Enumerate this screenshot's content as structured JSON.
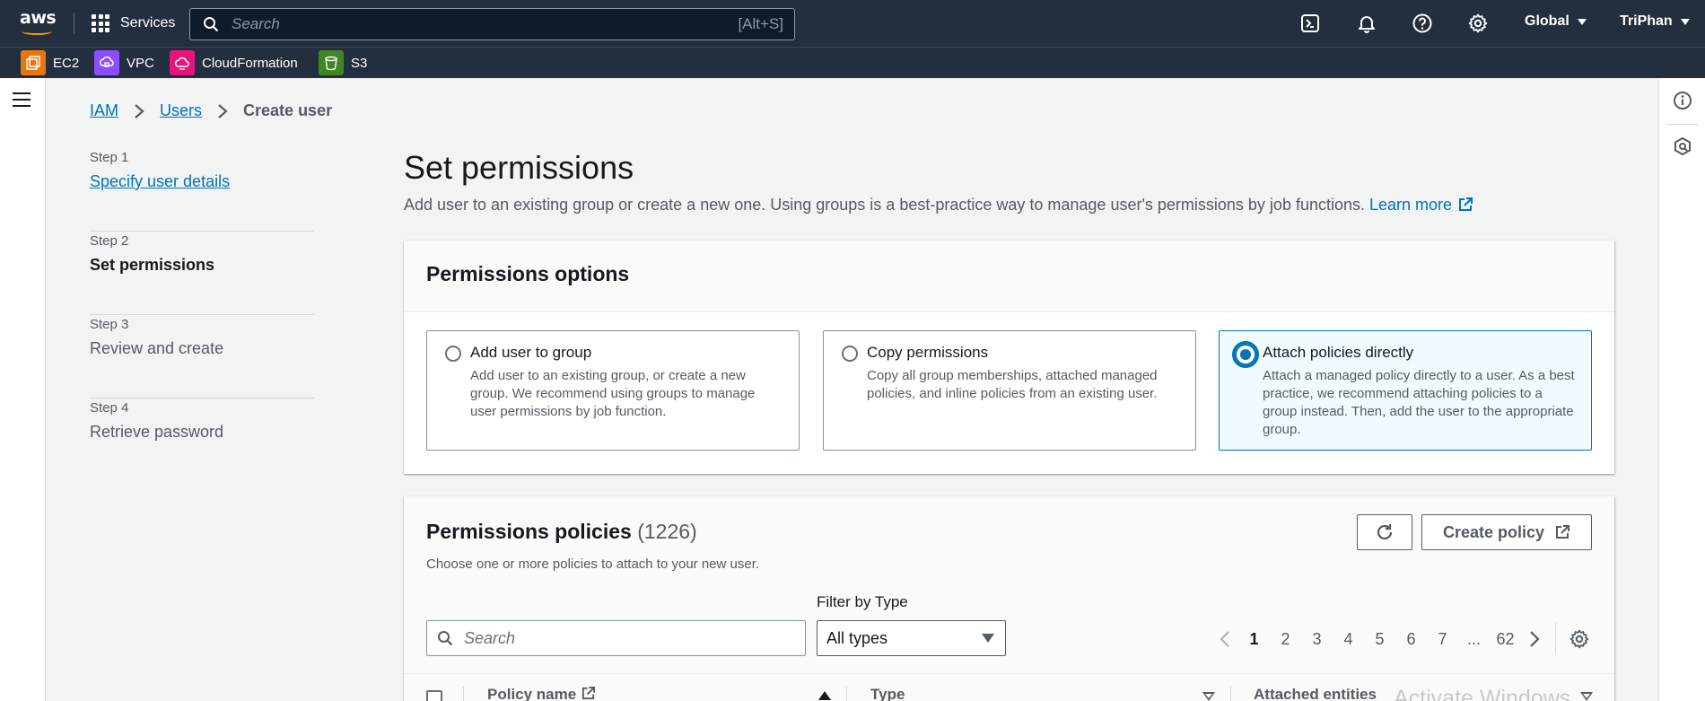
{
  "topnav": {
    "logo_text": "aws",
    "services_label": "Services",
    "search_placeholder": "Search",
    "search_shortcut": "[Alt+S]",
    "region": "Global",
    "user": "TriPhan",
    "icons": [
      "cloudshell-icon",
      "notifications-icon",
      "help-icon",
      "settings-icon"
    ]
  },
  "favorites": [
    {
      "label": "EC2",
      "color": "#e8760b",
      "icon": "ec2-icon"
    },
    {
      "label": "VPC",
      "color": "#8c4fff",
      "icon": "vpc-icon"
    },
    {
      "label": "CloudFormation",
      "color": "#e7157b",
      "icon": "cloudformation-icon"
    },
    {
      "label": "S3",
      "color": "#3f8624",
      "icon": "s3-icon"
    }
  ],
  "breadcrumb": {
    "iam": "IAM",
    "users": "Users",
    "current": "Create user"
  },
  "steps": [
    {
      "num": "Step 1",
      "title": "Specify user details"
    },
    {
      "num": "Step 2",
      "title": "Set permissions"
    },
    {
      "num": "Step 3",
      "title": "Review and create"
    },
    {
      "num": "Step 4",
      "title": "Retrieve password"
    }
  ],
  "main": {
    "title": "Set permissions",
    "description": "Add user to an existing group or create a new one. Using groups is a best-practice way to manage user's permissions by job functions.",
    "learn_more": "Learn more"
  },
  "permission_options": {
    "header": "Permissions options",
    "options": [
      {
        "title": "Add user to group",
        "desc": "Add user to an existing group, or create a new group. We recommend using groups to manage user permissions by job function.",
        "selected": false
      },
      {
        "title": "Copy permissions",
        "desc": "Copy all group memberships, attached managed policies, and inline policies from an existing user.",
        "selected": false
      },
      {
        "title": "Attach policies directly",
        "desc": "Attach a managed policy directly to a user. As a best practice, we recommend attaching policies to a group instead. Then, add the user to the appropriate group.",
        "selected": true
      }
    ]
  },
  "permission_policies": {
    "header": "Permissions policies",
    "count": "(1226)",
    "subtitle": "Choose one or more policies to attach to your new user.",
    "create_policy": "Create policy",
    "filter_label": "Filter by Type",
    "search_placeholder": "Search",
    "type_selected": "All types",
    "pagination": {
      "pages": [
        "1",
        "2",
        "3",
        "4",
        "5",
        "6",
        "7",
        "...",
        "62"
      ],
      "current": "1"
    },
    "columns": {
      "policy_name": "Policy name",
      "type": "Type",
      "attached": "Attached entities"
    }
  },
  "watermark": "Activate Windows",
  "colors": {
    "nav_bg": "#232f3e",
    "link": "#0073bb",
    "selected_tile_bg": "#f1faff",
    "page_bg": "#f2f3f3"
  }
}
